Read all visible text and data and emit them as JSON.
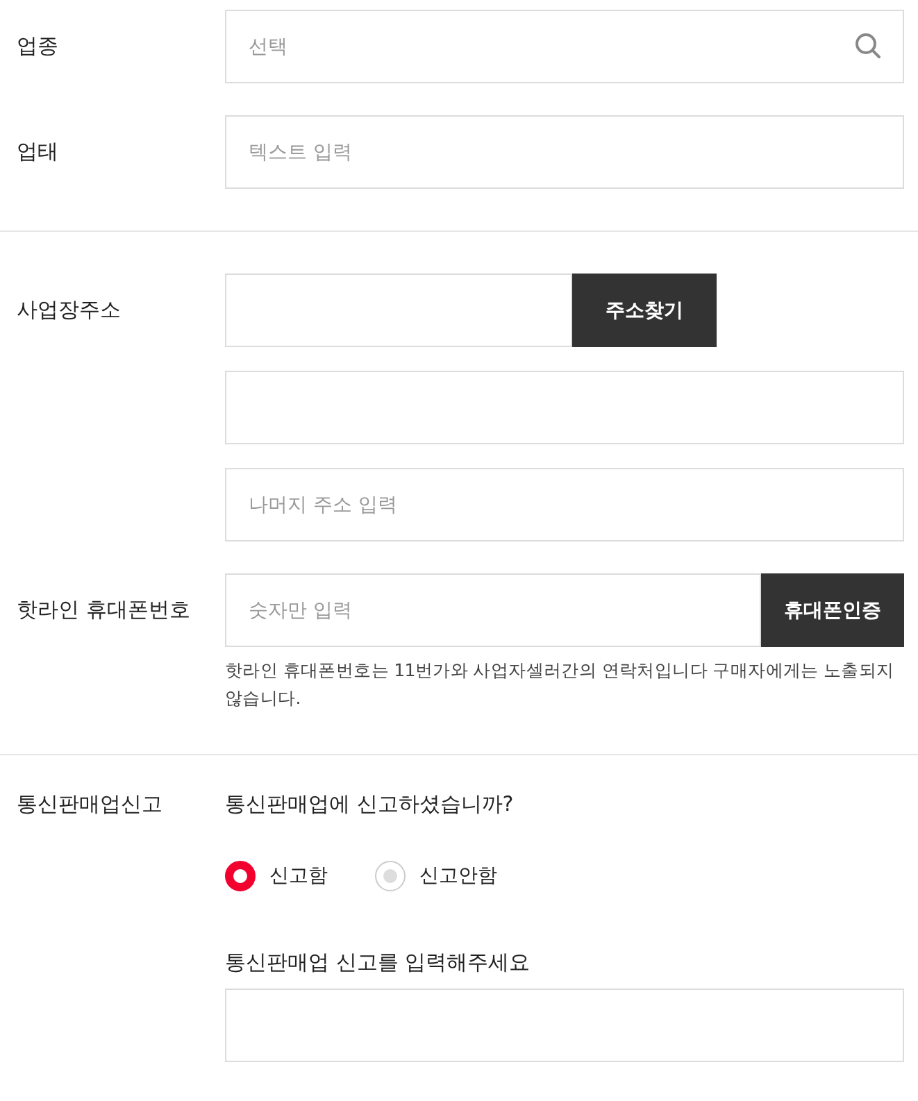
{
  "sections": [
    {
      "rows": [
        {
          "label": "업종",
          "controls": [
            {
              "kind": "search",
              "placeholder": "선택"
            }
          ]
        },
        {
          "label": "업태",
          "controls": [
            {
              "kind": "text",
              "placeholder": "텍스트 입력"
            }
          ]
        }
      ]
    },
    {
      "rows": [
        {
          "label": "사업장주소",
          "controls": [
            {
              "kind": "short_button",
              "button": "주소찾기"
            },
            {
              "kind": "text"
            },
            {
              "kind": "text",
              "placeholder": "나머지 주소 입력"
            }
          ]
        },
        {
          "label": "핫라인 휴대폰번호",
          "controls": [
            {
              "kind": "wide_button",
              "placeholder": "숫자만 입력",
              "button": "휴대폰인증"
            },
            {
              "kind": "help",
              "text": "핫라인 휴대폰번호는 11번가와 사업자셀러간의 연락처입니다 구매자에게는 노출되지 않습니다."
            }
          ]
        }
      ]
    },
    {
      "rows": [
        {
          "label": "통신판매업신고",
          "controls": [
            {
              "kind": "question",
              "text": "통신판매업에 신고하셨습니까?"
            },
            {
              "kind": "radios",
              "options": [
                {
                  "label": "신고함",
                  "selected": true
                },
                {
                  "label": "신고안함",
                  "selected": false
                }
              ]
            },
            {
              "kind": "prompt",
              "text": "통신판매업 신고를 입력해주세요"
            },
            {
              "kind": "text"
            }
          ]
        }
      ]
    }
  ]
}
